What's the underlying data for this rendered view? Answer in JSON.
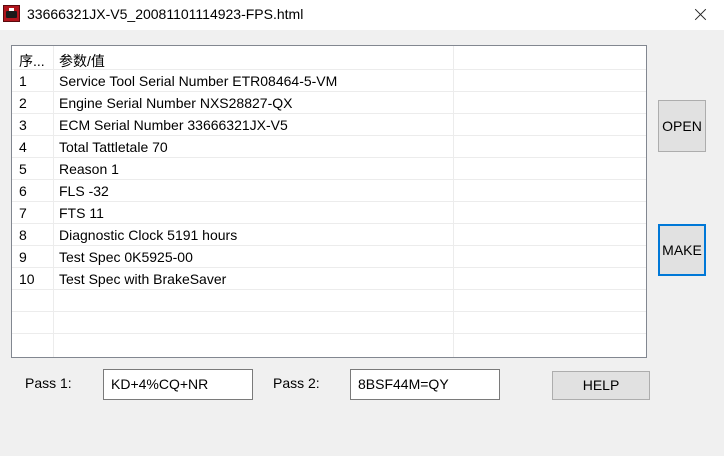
{
  "window": {
    "title": "33666321JX-V5_20081101114923-FPS.html",
    "icon": "truck-app-icon",
    "close_icon": "close-icon"
  },
  "list": {
    "headers": [
      "序...",
      "参数/值",
      ""
    ],
    "rows": [
      {
        "index": "1",
        "value": "Service Tool Serial Number ETR08464-5-VM"
      },
      {
        "index": "2",
        "value": "Engine Serial Number NXS28827-QX"
      },
      {
        "index": "3",
        "value": "ECM Serial Number 33666321JX-V5"
      },
      {
        "index": "4",
        "value": "Total Tattletale 70"
      },
      {
        "index": "5",
        "value": "Reason 1"
      },
      {
        "index": "6",
        "value": "FLS -32"
      },
      {
        "index": "7",
        "value": "FTS 11"
      },
      {
        "index": "8",
        "value": "Diagnostic Clock 5191 hours"
      },
      {
        "index": "9",
        "value": "Test Spec 0K5925-00"
      },
      {
        "index": "10",
        "value": "Test Spec with BrakeSaver"
      }
    ]
  },
  "buttons": {
    "open": "OPEN",
    "make": "MAKE",
    "help": "HELP"
  },
  "pass": {
    "pass1_label": "Pass 1:",
    "pass1_value": "KD+4%CQ+NR",
    "pass2_label": "Pass 2:",
    "pass2_value": "8BSF44M=QY"
  }
}
